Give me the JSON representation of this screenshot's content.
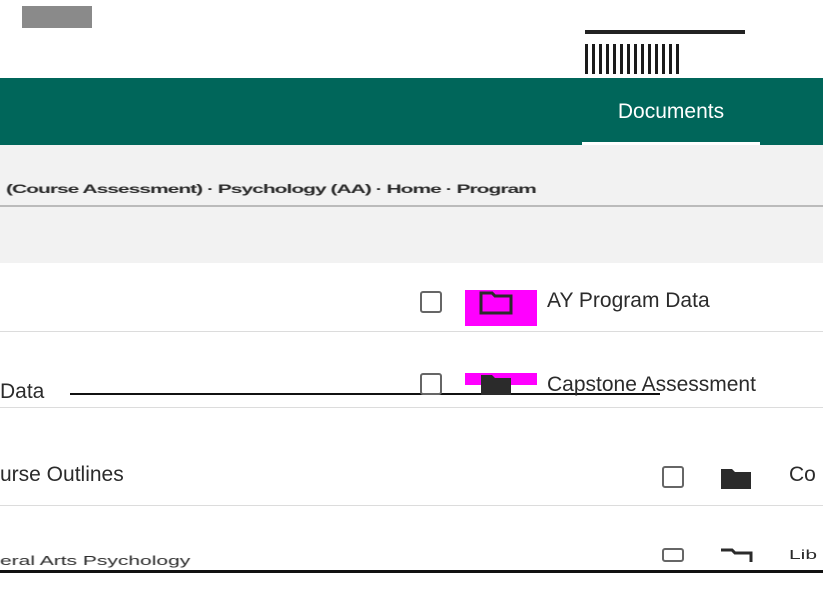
{
  "header": {
    "active_tab": "Documents"
  },
  "breadcrumb": {
    "text": "(Course Assessment) · Psychology (AA) · Home · Program"
  },
  "rows": [
    {
      "left_text": "",
      "name": "AY Program Data"
    },
    {
      "left_text": "Data",
      "name": "Capstone Assessment"
    },
    {
      "left_text": "urse Outlines",
      "name": "Co"
    },
    {
      "left_text": "eral Arts Psychology",
      "name": "Lib"
    }
  ],
  "colors": {
    "header_bg": "#00665a",
    "highlight": "#ff00ff",
    "band_bg": "#f2f2f2"
  },
  "icons": [
    "checkbox-icon",
    "folder-icon"
  ]
}
